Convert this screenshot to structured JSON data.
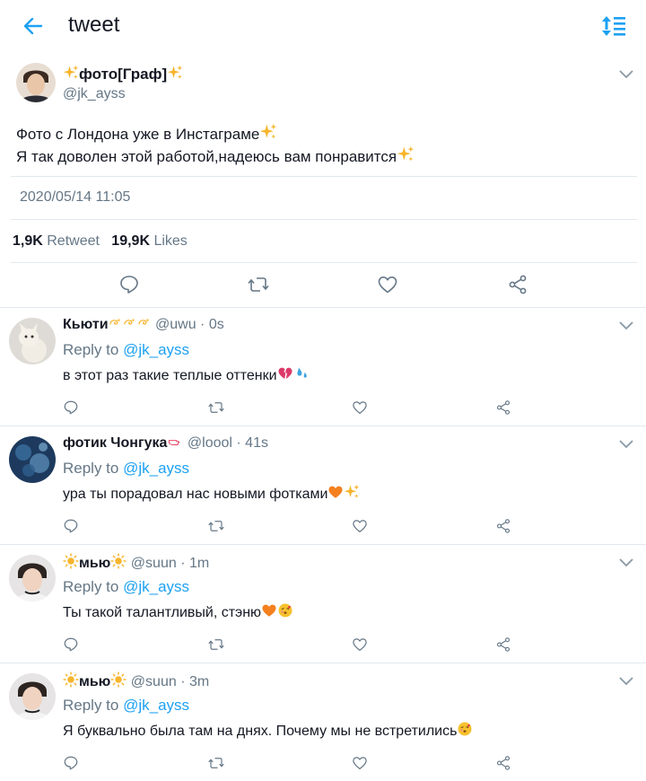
{
  "header": {
    "title": "tweet"
  },
  "tweet": {
    "author_name": "фото[Граф]",
    "handle": "@jk_ayss",
    "text_line1": "Фото с Лондона уже в Инстаграме",
    "text_line2": "Я так доволен этой работой,надеюсь вам понравится",
    "timestamp": "2020/05/14 11:05",
    "retweet_count": "1,9K",
    "retweet_label": "Retweet",
    "like_count": "19,9K",
    "like_label": "Likes"
  },
  "replies": [
    {
      "name": "Кьюти",
      "handle": "@uwu",
      "time": "0s",
      "reply_to_label": "Reply to",
      "reply_to_handle": "@jk_ayss",
      "text": "в этот раз такие теплые оттенки"
    },
    {
      "name": "фотик Чонгука",
      "handle": "@loool",
      "time": "41s",
      "reply_to_label": "Reply to",
      "reply_to_handle": "@jk_ayss",
      "text": "ура ты порадовал нас новыми фотками"
    },
    {
      "name": "мью",
      "handle": "@suun",
      "time": "1m",
      "reply_to_label": "Reply to",
      "reply_to_handle": "@jk_ayss",
      "text": "Ты такой талантливый, стэню"
    },
    {
      "name": "мью",
      "handle": "@suun",
      "time": "3m",
      "reply_to_label": "Reply to",
      "reply_to_handle": "@jk_ayss",
      "text": "Я буквально была там на днях. Почему мы не встретились"
    }
  ],
  "separator": "·",
  "colors": {
    "accent": "#1da1f2",
    "text": "#141823",
    "muted": "#657786",
    "divider": "#e1e8ed",
    "sparkle": "#f7b52c",
    "heart_orange": "#f4801f"
  }
}
